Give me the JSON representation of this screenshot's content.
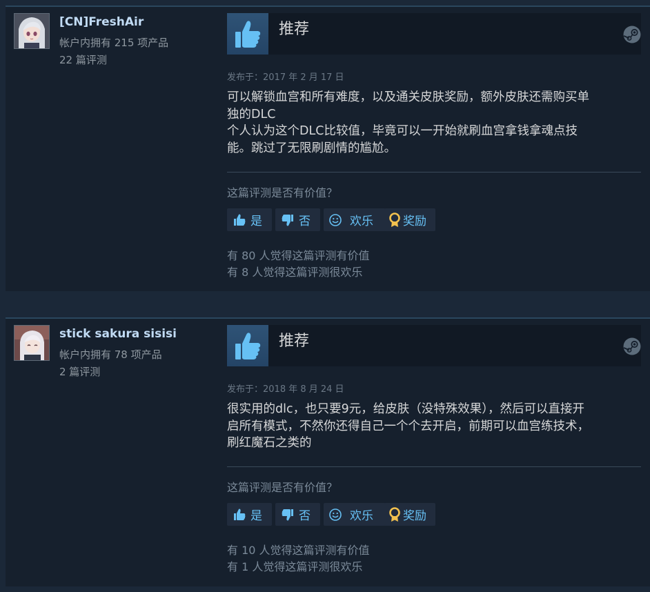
{
  "reviews": [
    {
      "author": "[CN]FreshAir",
      "products_owned": "帐户内拥有 215 项产品",
      "review_count": "22 篇评测",
      "verdict": "推荐",
      "posted_date": "发布于：2017 年 2 月 17 日",
      "text_lines": [
        "可以解锁血宫和所有难度，以及通关皮肤奖励，额外皮肤还需购买单",
        "独的DLC",
        "个人认为这个DLC比较值，毕竟可以一开始就刷血宫拿钱拿魂点技",
        "能。跳过了无限刷剧情的尴尬。"
      ],
      "helpful_question": "这篇评测是否有价值？",
      "buttons": {
        "yes": "是",
        "no": "否",
        "funny": "欢乐",
        "award": "奖励"
      },
      "helpful_stat": "有 80 人觉得这篇评测有价值",
      "funny_stat": "有 8 人觉得这篇评测很欢乐"
    },
    {
      "author": "stick sakura sisisi",
      "products_owned": "帐户内拥有 78 项产品",
      "review_count": "2 篇评测",
      "verdict": "推荐",
      "posted_date": "发布于：2018 年 8 月 24 日",
      "text_lines": [
        "很实用的dlc，也只要9元，给皮肤（没特殊效果），然后可以直接开",
        "启所有模式，不然你还得自己一个个去开启，前期可以血宫练技术，",
        "刷红魔石之类的"
      ],
      "helpful_question": "这篇评测是否有价值？",
      "buttons": {
        "yes": "是",
        "no": "否",
        "funny": "欢乐",
        "award": "奖励"
      },
      "helpful_stat": "有 10 人觉得这篇评测有价值",
      "funny_stat": "有 1 人觉得这篇评测很欢乐"
    }
  ],
  "colors": {
    "background": "#1b2838",
    "card": "#16202d",
    "author_name": "#c1dbf4",
    "link_blue": "#67c1f5",
    "award_gold": "#f2c14e"
  },
  "icons": {
    "thumbs_up": "thumbs-up-icon",
    "thumbs_down": "thumbs-down-icon",
    "smiley": "smiley-icon",
    "award": "award-icon",
    "steam": "steam-logo-icon"
  }
}
